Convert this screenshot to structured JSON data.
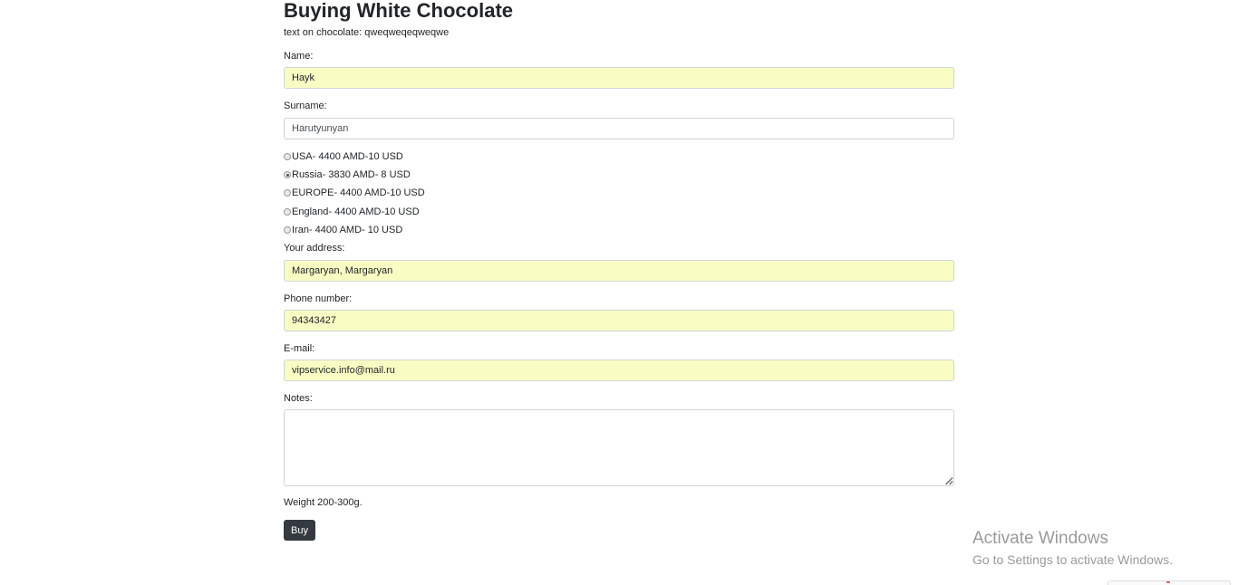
{
  "header": {
    "title": "Buying White Chocolate",
    "subtitle": "text on chocolate: qweqweqeqweqwe"
  },
  "form": {
    "name": {
      "label": "Name:",
      "value": "Hayk"
    },
    "surname": {
      "label": "Surname:",
      "value": "Harutyunyan"
    },
    "shipping_options": [
      {
        "label": "USA- 4400 AMD-10 USD",
        "checked": false
      },
      {
        "label": "Russia- 3830 AMD- 8 USD",
        "checked": true
      },
      {
        "label": "EUROPE- 4400 AMD-10 USD",
        "checked": false
      },
      {
        "label": "England- 4400 AMD-10 USD",
        "checked": false
      },
      {
        "label": "Iran- 4400 AMD- 10 USD",
        "checked": false
      }
    ],
    "address": {
      "label": "Your address:",
      "value": "Margaryan, Margaryan"
    },
    "phone": {
      "label": "Phone number:",
      "value": "94343427"
    },
    "email": {
      "label": "E-mail:",
      "value": "vipservice.info@mail.ru"
    },
    "notes": {
      "label": "Notes:",
      "value": ""
    },
    "weight_note": "Weight 200-300g.",
    "buy_label": "Buy"
  },
  "watermark": {
    "title": "Activate Windows",
    "subtitle": "Go to Settings to activate Windows."
  },
  "colors": {
    "autofill_background": "#fafdc3",
    "button_background": "#343a40",
    "input_border": "#ced4da"
  }
}
